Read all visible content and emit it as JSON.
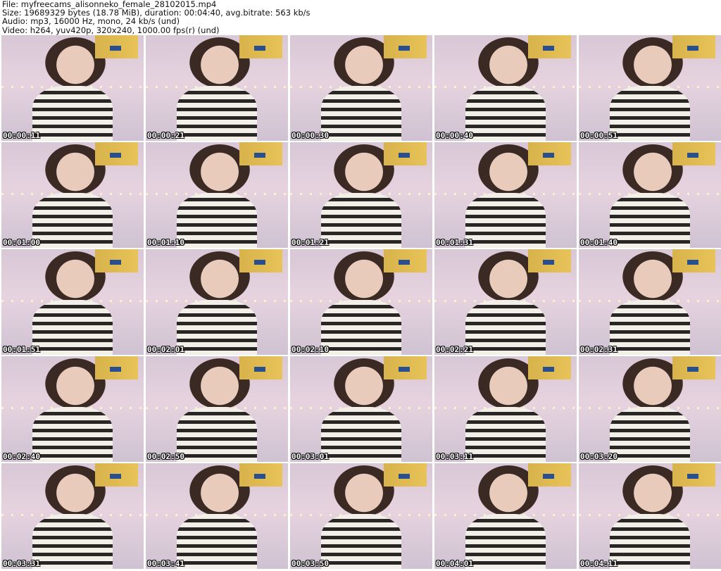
{
  "header": {
    "file": "File: myfreecams_alisonneko_female_28102015.mp4",
    "size": "Size: 19689329 bytes (18.78 MiB), duration: 00:04:40, avg.bitrate: 563 kb/s",
    "audio": "Audio: mp3, 16000 Hz, mono, 24 kb/s (und)",
    "video": "Video: h264, yuv420p, 320x240, 1000.00 fps(r) (und)"
  },
  "thumbnails": [
    "00:00:11",
    "00:00:21",
    "00:00:30",
    "00:00:40",
    "00:00:51",
    "00:01:00",
    "00:01:10",
    "00:01:21",
    "00:01:31",
    "00:01:40",
    "00:01:51",
    "00:02:01",
    "00:02:10",
    "00:02:21",
    "00:02:31",
    "00:02:40",
    "00:02:50",
    "00:03:01",
    "00:03:11",
    "00:03:20",
    "00:03:31",
    "00:03:41",
    "00:03:50",
    "00:04:01",
    "00:04:11"
  ]
}
